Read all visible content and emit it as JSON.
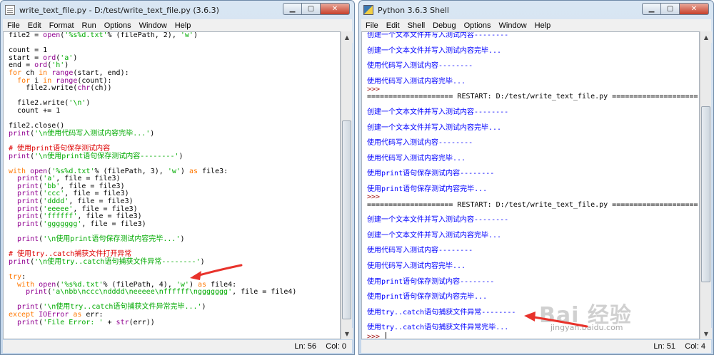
{
  "left_window": {
    "title": "write_text_file.py - D:/test/write_text_file.py (3.6.3)",
    "menus": [
      "File",
      "Edit",
      "Format",
      "Run",
      "Options",
      "Window",
      "Help"
    ],
    "status_ln": "Ln: 56",
    "status_col": "Col: 0",
    "code_lines": [
      [
        [
          "file2 = ",
          "n"
        ],
        [
          "open",
          "bi"
        ],
        [
          "(",
          "n"
        ],
        [
          "'%s%d.txt'",
          "st"
        ],
        [
          "% (filePath, 2), ",
          "n"
        ],
        [
          "'w'",
          "st"
        ],
        [
          ")",
          "n"
        ]
      ],
      [],
      [
        [
          "count = 1",
          "n"
        ]
      ],
      [
        [
          "start = ",
          "n"
        ],
        [
          "ord",
          "bi"
        ],
        [
          "(",
          "n"
        ],
        [
          "'a'",
          "st"
        ],
        [
          ")",
          "n"
        ]
      ],
      [
        [
          "end = ",
          "n"
        ],
        [
          "ord",
          "bi"
        ],
        [
          "(",
          "n"
        ],
        [
          "'h'",
          "st"
        ],
        [
          ")",
          "n"
        ]
      ],
      [
        [
          "for",
          "kw"
        ],
        [
          " ch ",
          "n"
        ],
        [
          "in",
          "kw"
        ],
        [
          " ",
          "n"
        ],
        [
          "range",
          "bi"
        ],
        [
          "(start, end):",
          "n"
        ]
      ],
      [
        [
          "  ",
          "n"
        ],
        [
          "for",
          "kw"
        ],
        [
          " i ",
          "n"
        ],
        [
          "in",
          "kw"
        ],
        [
          " ",
          "n"
        ],
        [
          "range",
          "bi"
        ],
        [
          "(count):",
          "n"
        ]
      ],
      [
        [
          "    file2.write(",
          "n"
        ],
        [
          "chr",
          "bi"
        ],
        [
          "(ch))",
          "n"
        ]
      ],
      [],
      [
        [
          "  file2.write(",
          "n"
        ],
        [
          "'\\n'",
          "st"
        ],
        [
          ")",
          "n"
        ]
      ],
      [
        [
          "  count += 1",
          "n"
        ]
      ],
      [],
      [
        [
          "file2.close()",
          "n"
        ]
      ],
      [
        [
          "print",
          "bi"
        ],
        [
          "(",
          "n"
        ],
        [
          "'\\n使用代码写入测试内容完毕...'",
          "st"
        ],
        [
          ")",
          "n"
        ]
      ],
      [],
      [
        [
          "# 使用print语句保存测试内容",
          "cm"
        ]
      ],
      [
        [
          "print",
          "bi"
        ],
        [
          "(",
          "n"
        ],
        [
          "'\\n使用print语句保存测试内容--------'",
          "st"
        ],
        [
          ")",
          "n"
        ]
      ],
      [],
      [
        [
          "with",
          "kw"
        ],
        [
          " ",
          "n"
        ],
        [
          "open",
          "bi"
        ],
        [
          "(",
          "n"
        ],
        [
          "'%s%d.txt'",
          "st"
        ],
        [
          "% (filePath, 3), ",
          "n"
        ],
        [
          "'w'",
          "st"
        ],
        [
          ") ",
          "n"
        ],
        [
          "as",
          "kw"
        ],
        [
          " file3:",
          "n"
        ]
      ],
      [
        [
          "  ",
          "n"
        ],
        [
          "print",
          "bi"
        ],
        [
          "(",
          "n"
        ],
        [
          "'a'",
          "st"
        ],
        [
          ", file = file3)",
          "n"
        ]
      ],
      [
        [
          "  ",
          "n"
        ],
        [
          "print",
          "bi"
        ],
        [
          "(",
          "n"
        ],
        [
          "'bb'",
          "st"
        ],
        [
          ", file = file3)",
          "n"
        ]
      ],
      [
        [
          "  ",
          "n"
        ],
        [
          "print",
          "bi"
        ],
        [
          "(",
          "n"
        ],
        [
          "'ccc'",
          "st"
        ],
        [
          ", file = file3)",
          "n"
        ]
      ],
      [
        [
          "  ",
          "n"
        ],
        [
          "print",
          "bi"
        ],
        [
          "(",
          "n"
        ],
        [
          "'dddd'",
          "st"
        ],
        [
          ", file = file3)",
          "n"
        ]
      ],
      [
        [
          "  ",
          "n"
        ],
        [
          "print",
          "bi"
        ],
        [
          "(",
          "n"
        ],
        [
          "'eeeee'",
          "st"
        ],
        [
          ", file = file3)",
          "n"
        ]
      ],
      [
        [
          "  ",
          "n"
        ],
        [
          "print",
          "bi"
        ],
        [
          "(",
          "n"
        ],
        [
          "'ffffff'",
          "st"
        ],
        [
          ", file = file3)",
          "n"
        ]
      ],
      [
        [
          "  ",
          "n"
        ],
        [
          "print",
          "bi"
        ],
        [
          "(",
          "n"
        ],
        [
          "'ggggggg'",
          "st"
        ],
        [
          ", file = file3)",
          "n"
        ]
      ],
      [],
      [
        [
          "  ",
          "n"
        ],
        [
          "print",
          "bi"
        ],
        [
          "(",
          "n"
        ],
        [
          "'\\n使用print语句保存测试内容完毕...'",
          "st"
        ],
        [
          ")",
          "n"
        ]
      ],
      [],
      [
        [
          "# 使用try..catch捕获文件打开异常",
          "cm"
        ]
      ],
      [
        [
          "print",
          "bi"
        ],
        [
          "(",
          "n"
        ],
        [
          "'\\n使用try..catch语句捕获文件异常--------'",
          "st"
        ],
        [
          ")",
          "n"
        ]
      ],
      [],
      [
        [
          "try",
          "kw"
        ],
        [
          ":",
          "n"
        ]
      ],
      [
        [
          "  ",
          "n"
        ],
        [
          "with",
          "kw"
        ],
        [
          " ",
          "n"
        ],
        [
          "open",
          "bi"
        ],
        [
          "(",
          "n"
        ],
        [
          "'%s%d.txt'",
          "st"
        ],
        [
          "% (filePath, 4), ",
          "n"
        ],
        [
          "'w'",
          "st"
        ],
        [
          ") ",
          "n"
        ],
        [
          "as",
          "kw"
        ],
        [
          " file4:",
          "n"
        ]
      ],
      [
        [
          "    ",
          "n"
        ],
        [
          "print",
          "bi"
        ],
        [
          "(",
          "n"
        ],
        [
          "'a\\nbb\\nccc\\ndddd\\neeeee\\nffffff\\nggggggg'",
          "st"
        ],
        [
          ", file = file4)",
          "n"
        ]
      ],
      [],
      [
        [
          "  ",
          "n"
        ],
        [
          "print",
          "bi"
        ],
        [
          "(",
          "n"
        ],
        [
          "'\\n使用try..catch语句捕获文件异常完毕...'",
          "st"
        ],
        [
          ")",
          "n"
        ]
      ],
      [
        [
          "except",
          "kw"
        ],
        [
          " ",
          "n"
        ],
        [
          "IOError",
          "bi"
        ],
        [
          " ",
          "n"
        ],
        [
          "as",
          "kw"
        ],
        [
          " err:",
          "n"
        ]
      ],
      [
        [
          "  ",
          "n"
        ],
        [
          "print",
          "bi"
        ],
        [
          "(",
          "n"
        ],
        [
          "'File Error: '",
          "st"
        ],
        [
          " + ",
          "n"
        ],
        [
          "str",
          "bi"
        ],
        [
          "(err))",
          "n"
        ]
      ]
    ]
  },
  "right_window": {
    "title": "Python 3.6.3 Shell",
    "menus": [
      "File",
      "Edit",
      "Shell",
      "Debug",
      "Options",
      "Window",
      "Help"
    ],
    "status_ln": "Ln: 51",
    "status_col": "Col: 4",
    "shell_lines": [
      [
        "ou",
        "创建一个文本文件并写入测试内容--------"
      ],
      [
        "gap",
        ""
      ],
      [
        "ou",
        "创建一个文本文件并写入测试内容完毕..."
      ],
      [
        "gap",
        ""
      ],
      [
        "ou",
        "使用代码写入测试内容--------"
      ],
      [
        "gap",
        ""
      ],
      [
        "ou",
        "使用代码写入测试内容完毕..."
      ],
      [
        "pr",
        ">>> "
      ],
      [
        "n",
        "==================== RESTART: D:/test/write_text_file.py ===================="
      ],
      [
        "gap",
        ""
      ],
      [
        "ou",
        "创建一个文本文件并写入测试内容--------"
      ],
      [
        "gap",
        ""
      ],
      [
        "ou",
        "创建一个文本文件并写入测试内容完毕..."
      ],
      [
        "gap",
        ""
      ],
      [
        "ou",
        "使用代码写入测试内容--------"
      ],
      [
        "gap",
        ""
      ],
      [
        "ou",
        "使用代码写入测试内容完毕..."
      ],
      [
        "gap",
        ""
      ],
      [
        "ou",
        "使用print语句保存测试内容--------"
      ],
      [
        "gap",
        ""
      ],
      [
        "ou",
        "使用print语句保存测试内容完毕..."
      ],
      [
        "pr",
        ">>> "
      ],
      [
        "n",
        "==================== RESTART: D:/test/write_text_file.py ===================="
      ],
      [
        "gap",
        ""
      ],
      [
        "ou",
        "创建一个文本文件并写入测试内容--------"
      ],
      [
        "gap",
        ""
      ],
      [
        "ou",
        "创建一个文本文件并写入测试内容完毕..."
      ],
      [
        "gap",
        ""
      ],
      [
        "ou",
        "使用代码写入测试内容--------"
      ],
      [
        "gap",
        ""
      ],
      [
        "ou",
        "使用代码写入测试内容完毕..."
      ],
      [
        "gap",
        ""
      ],
      [
        "ou",
        "使用print语句保存测试内容--------"
      ],
      [
        "gap",
        ""
      ],
      [
        "ou",
        "使用print语句保存测试内容完毕..."
      ],
      [
        "gap",
        ""
      ],
      [
        "ou",
        "使用try..catch语句捕获文件异常--------"
      ],
      [
        "gap",
        ""
      ],
      [
        "ou",
        "使用try..catch语句捕获文件异常完毕..."
      ],
      [
        "prompt",
        ">>> "
      ]
    ]
  },
  "window_buttons": {
    "minimize": "▁",
    "maximize": "▢",
    "close": "✕"
  },
  "watermark": {
    "brand": "Bai 经验",
    "url": "jingyan.baidu.com"
  },
  "colors": {
    "arrow": "#e8322b",
    "output_blue": "#0000ff",
    "string_green": "#00aa00",
    "keyword_orange": "#ff7700",
    "builtin_purple": "#900090",
    "comment_red": "#dd0000"
  }
}
